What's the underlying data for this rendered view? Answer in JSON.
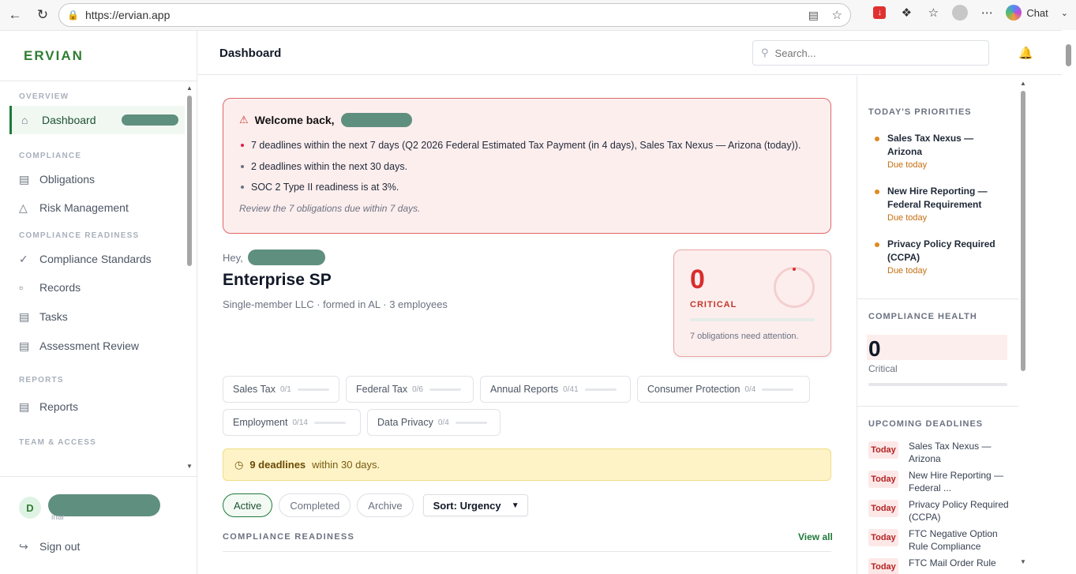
{
  "browser": {
    "url": "https://ervian.app",
    "chat_label": "Chat"
  },
  "sidebar": {
    "logo": "ERVIAN",
    "sections": [
      {
        "label": "OVERVIEW"
      },
      {
        "label": "COMPLIANCE"
      },
      {
        "label": "COMPLIANCE READINESS"
      },
      {
        "label": "REPORTS"
      },
      {
        "label": "TEAM & ACCESS"
      }
    ],
    "items": {
      "dashboard": "Dashboard",
      "obligations": "Obligations",
      "risk_management": "Risk Management",
      "compliance_standards": "Compliance Standards",
      "records": "Records",
      "tasks": "Tasks",
      "assessment_review": "Assessment Review",
      "reports": "Reports"
    },
    "user_initial": "D",
    "user_sub": "inar",
    "sign_out": "Sign out"
  },
  "header": {
    "title": "Dashboard",
    "search_placeholder": "Search..."
  },
  "welcome": {
    "heading": "Welcome back,",
    "bullets": [
      "7 deadlines within the next 7 days (Q2 2026 Federal Estimated Tax Payment (in 4 days), Sales Tax Nexus — Arizona (today)).",
      "2 deadlines within the next 30 days.",
      "SOC 2 Type II readiness is at 3%."
    ],
    "review": "Review the 7 obligations due within 7 days."
  },
  "entity": {
    "hey": "Hey,",
    "name": "Enterprise SP",
    "subtitle": "Single-member LLC · formed in AL · 3 employees"
  },
  "critical_card": {
    "count": "0",
    "label": "CRITICAL",
    "note": "7 obligations need attention."
  },
  "categories": [
    {
      "name": "Sales Tax",
      "count": "0/1"
    },
    {
      "name": "Federal Tax",
      "count": "0/6"
    },
    {
      "name": "Annual Reports",
      "count": "0/41"
    },
    {
      "name": "Consumer Protection",
      "count": "0/4"
    },
    {
      "name": "Employment",
      "count": "0/14"
    },
    {
      "name": "Data Privacy",
      "count": "0/4"
    }
  ],
  "deadline_banner": {
    "strong": "9 deadlines",
    "rest": "within 30 days."
  },
  "tabs": [
    "Active",
    "Completed",
    "Archive"
  ],
  "sort_label": "Sort: Urgency",
  "readiness": {
    "label": "COMPLIANCE READINESS",
    "view_all": "View all"
  },
  "right_panel": {
    "priorities_title": "TODAY'S PRIORITIES",
    "priorities": [
      {
        "title": "Sales Tax Nexus — Arizona",
        "due": "Due today"
      },
      {
        "title": "New Hire Reporting — Federal Requirement",
        "due": "Due today"
      },
      {
        "title": "Privacy Policy Required (CCPA)",
        "due": "Due today"
      }
    ],
    "health_title": "COMPLIANCE HEALTH",
    "health_value": "0",
    "health_label": "Critical",
    "deadlines_title": "UPCOMING DEADLINES",
    "deadlines": [
      {
        "badge": "Today",
        "title": "Sales Tax Nexus — Arizona"
      },
      {
        "badge": "Today",
        "title": "New Hire Reporting — Federal ..."
      },
      {
        "badge": "Today",
        "title": "Privacy Policy Required (CCPA)"
      },
      {
        "badge": "Today",
        "title": "FTC Negative Option Rule Compliance"
      },
      {
        "badge": "Today",
        "title": "FTC Mail Order Rule"
      }
    ]
  },
  "colors": {
    "brand": "#2f7d32",
    "critical": "#d92d2d",
    "due": "#c36f12"
  }
}
